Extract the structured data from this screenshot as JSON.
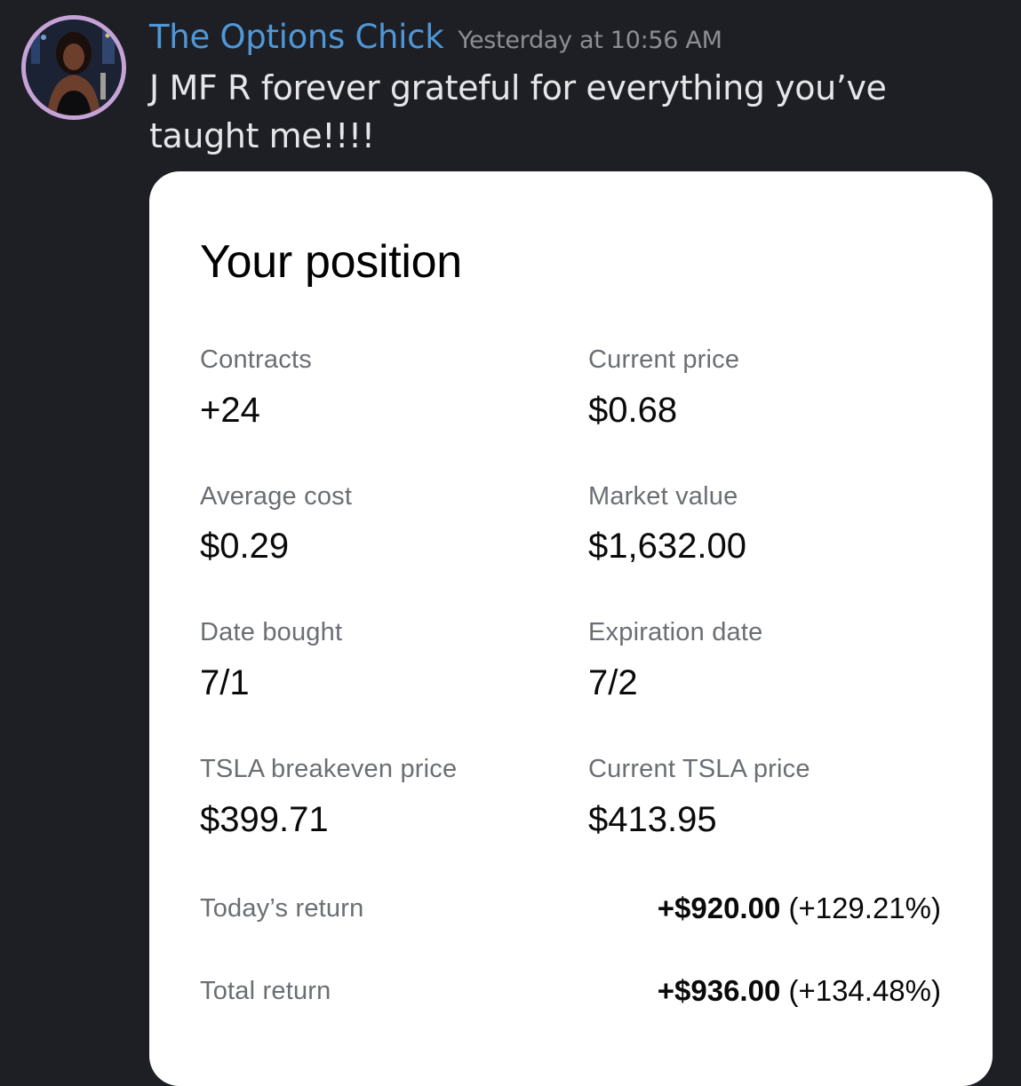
{
  "message": {
    "username": "The Options Chick",
    "timestamp": "Yesterday at 10:56 AM",
    "text": "J MF R forever grateful for everything you’ve taught me!!!!"
  },
  "card": {
    "title": "Your position",
    "fields": [
      {
        "label": "Contracts",
        "value": "+24"
      },
      {
        "label": "Current price",
        "value": "$0.68"
      },
      {
        "label": "Average cost",
        "value": "$0.29"
      },
      {
        "label": "Market value",
        "value": "$1,632.00"
      },
      {
        "label": "Date bought",
        "value": "7/1"
      },
      {
        "label": "Expiration date",
        "value": "7/2"
      },
      {
        "label": "TSLA breakeven price",
        "value": "$399.71"
      },
      {
        "label": "Current TSLA price",
        "value": "$413.95"
      }
    ],
    "returns": [
      {
        "label": "Today’s return",
        "amount": "+$920.00",
        "percent": "(+129.21%)"
      },
      {
        "label": "Total return",
        "amount": "+$936.00",
        "percent": "(+134.48%)"
      }
    ]
  },
  "colors": {
    "background": "#1e1f24",
    "username": "#4e97d8",
    "timestamp": "#8c8e94",
    "card": "#ffffff"
  }
}
